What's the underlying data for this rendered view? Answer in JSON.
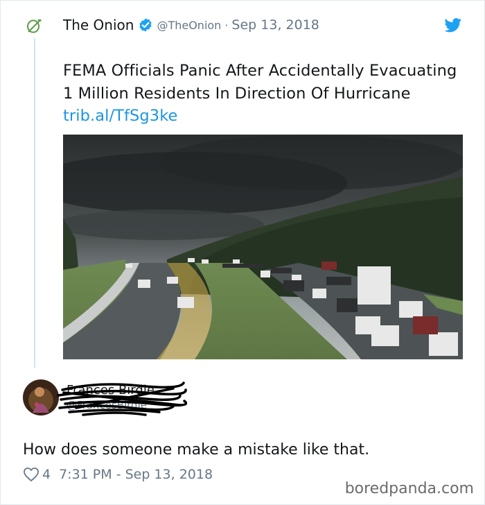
{
  "quoted_tweet": {
    "display_name": "The Onion",
    "handle": "@TheOnion",
    "separator": "·",
    "date": "Sep 13, 2018",
    "text": "FEMA Officials Panic After Accidentally Evacuating 1 Million Residents In Direction Of Hurricane",
    "link": "trib.al/TfSg3ke",
    "icons": {
      "logo": "onion-logo-icon",
      "verified": "verified-badge-icon",
      "platform": "twitter-bird-icon"
    },
    "colors": {
      "link": "#1b95e0",
      "verified": "#1da1f2",
      "logo": "#5a9a4a"
    }
  },
  "reply": {
    "display_name": "Frances Birdie",
    "handle": "@FrancesBirdie",
    "text": "How does someone make a mistake like that.",
    "likes": "4",
    "timestamp": "7:31 PM - Sep 13, 2018",
    "icons": {
      "like": "heart-icon"
    }
  },
  "watermark": "boredpanda.com"
}
